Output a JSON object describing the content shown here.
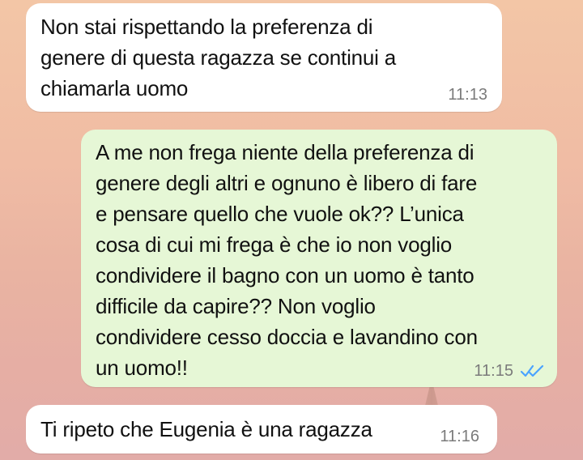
{
  "messages": [
    {
      "direction": "incoming",
      "text": "Non stai rispettando la preferenza di\ngenere di questa ragazza se continui a\nchiamarla uomo",
      "time": "11:13"
    },
    {
      "direction": "outgoing",
      "text": "A me non frega niente della preferenza di\ngenere degli altri e ognuno è libero di fare\ne pensare quello che vuole ok?? L’unica\ncosa di cui mi frega è che io non voglio\ncondividere il bagno con un uomo è tanto\ndifficile da capire?? Non voglio\ncondividere cesso doccia e lavandino con\nun uomo!!",
      "time": "11:15",
      "status_icon": "double-check-icon",
      "status_color": "#4aa3ff"
    },
    {
      "direction": "incoming",
      "text": "Ti ripeto che Eugenia è una ragazza",
      "time": "11:16"
    }
  ],
  "colors": {
    "incoming_bubble": "#ffffff",
    "outgoing_bubble": "#e6f7d6",
    "time_text": "#7b7b7b"
  }
}
